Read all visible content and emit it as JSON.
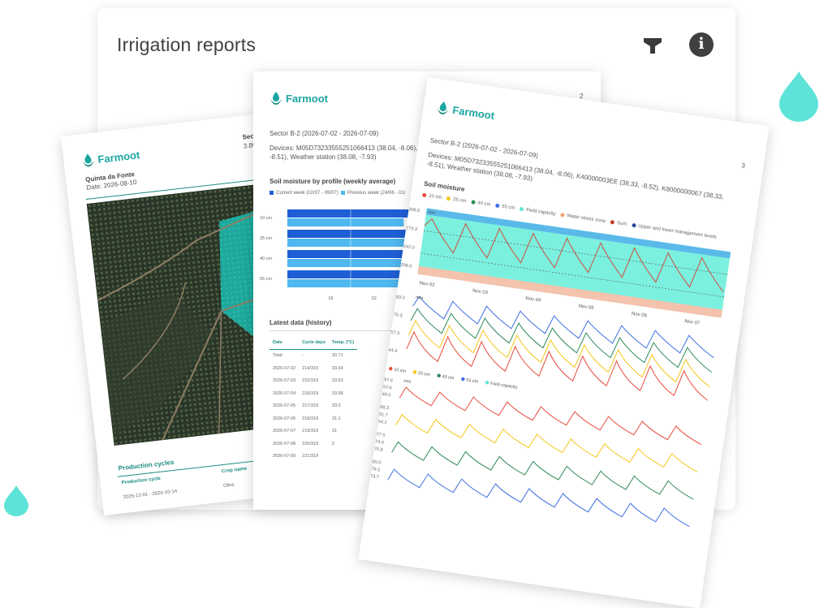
{
  "card": {
    "title": "Irrigation reports"
  },
  "icons": {
    "filter": "filter-icon",
    "info": "info-icon",
    "info_glyph": "i",
    "drop": "water-drop-icon"
  },
  "colors": {
    "accent": "#1c8c82",
    "brand": "#1ba6a0",
    "drop": "#5ee3d8",
    "field": "#1ea79a",
    "moisture_band": "#7cf0de",
    "blue_bar": "#1f5fd6",
    "light_bar": "#4fb8f0"
  },
  "brand": {
    "name": "Farmoot"
  },
  "page1": {
    "farm": "Quinta da Fonte",
    "date": "Date: 2026-08-10",
    "sector_frag": "Secto",
    "area_frag": "3.86 h",
    "production_title": "Production cycles",
    "col_cycle": "Production cycle",
    "col_crop": "Crop name",
    "row_cycle": "2025-12-01 - 2026-10-14",
    "row_crop": "Olive"
  },
  "page2": {
    "page_number": "2",
    "sector": "Sector B-2 (2026-07-02 - 2026-07-09)",
    "devices_l1": "Devices: M05D73233555251066413 (38.04, -8.06),",
    "devices_l2": "-8.51), Weather station (38.08, -7.93)",
    "chart_title": "Soil moisture by profile (weekly average)",
    "legend_current": "Current week (02/07 - 09/07)",
    "legend_previous": "Previous week (24/06 - 01/",
    "history_title": "Latest data (history)",
    "table_headers": [
      "Date",
      "Cycle days",
      "Temp. (°C)"
    ],
    "table_rows": [
      [
        "Total",
        "-",
        "30.71"
      ],
      [
        "2026-07-02",
        "214/319",
        "33.64"
      ],
      [
        "2026-07-03",
        "215/319",
        "33.63"
      ],
      [
        "2026-07-04",
        "216/319",
        "33.08"
      ],
      [
        "2026-07-05",
        "217/319",
        "33.0"
      ],
      [
        "2026-07-06",
        "218/319",
        "31.1"
      ],
      [
        "2026-07-07",
        "219/319",
        "31"
      ],
      [
        "2026-07-08",
        "220/319",
        "2"
      ],
      [
        "2026-07-09",
        "221/319",
        ""
      ]
    ]
  },
  "page3": {
    "page_number": "3",
    "sector": "Sector B-2 (2026-07-02 - 2026-07-09)",
    "devices_l1": "Devices: M05D73233555251066413 (38.04, -8.06), K40000003EE (38.33, -8.52), K8000000067 (38.33,",
    "devices_l2": "-8.51), Weather station (38.08, -7.93)",
    "chart_title": "Soil moisture",
    "legend1": [
      "10 cm",
      "25 cm",
      "40 cm",
      "55 cm",
      "Field capacity",
      "Water stress zone",
      "Sum",
      "Upper and lower management levels"
    ],
    "legend2": [
      "10 cm",
      "25 cm",
      "40 cm",
      "55 cm",
      "Field capacity"
    ],
    "unit_mm": "mm",
    "sum_ticks": [
      "306.6",
      "274.3",
      "242.0",
      "208.6"
    ],
    "date_ticks": [
      "Nov 02",
      "Nov 03",
      "Nov 04",
      "Nov 05",
      "Nov 06",
      "Nov 07"
    ],
    "mid_ticks": [
      "83.0",
      "70.3",
      "57.5",
      "44.4"
    ],
    "low_ticks": [
      "67.6",
      "57.6",
      "48.0",
      "68.3",
      "61.7",
      "54.2",
      "77.5",
      "74.0",
      "70.8",
      "85.0",
      "79.5",
      "73.7"
    ]
  },
  "chart_data": {
    "type": "bar",
    "title": "Soil moisture by profile (weekly average)",
    "orientation": "horizontal",
    "categories": [
      "10 cm",
      "25 cm",
      "40 cm",
      "55 cm"
    ],
    "x_ticks": [
      "16",
      "32"
    ],
    "xlim": [
      0,
      48
    ],
    "series": [
      {
        "name": "Current week (02/07 - 09/07)",
        "values": [
          47,
          47,
          47,
          47
        ]
      },
      {
        "name": "Previous week (24/06 - 01/",
        "values": [
          43,
          44,
          44,
          45
        ]
      }
    ],
    "legend": "top-left"
  }
}
